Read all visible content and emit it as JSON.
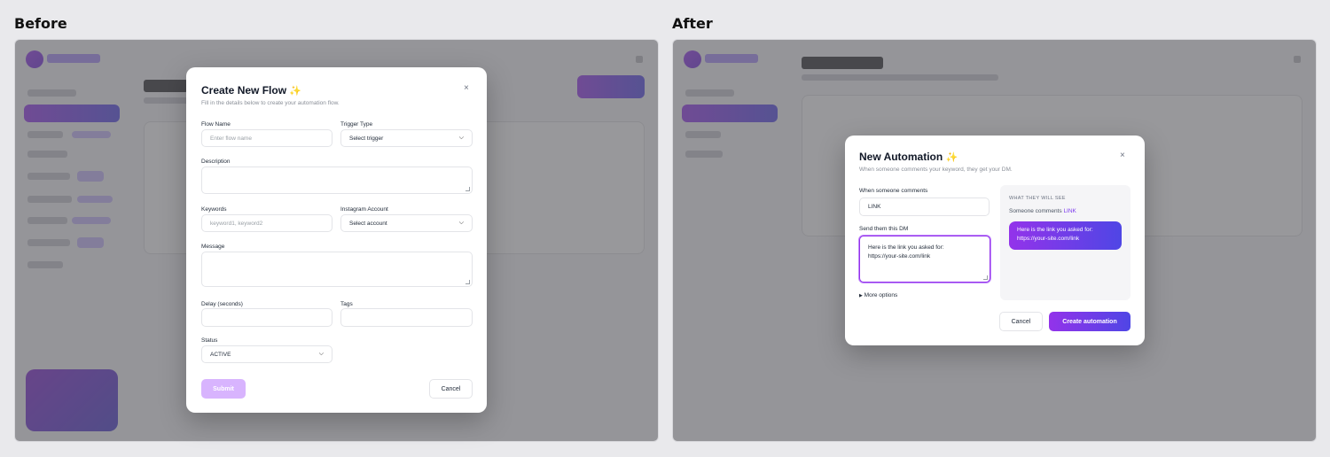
{
  "labels": {
    "before": "Before",
    "after": "After"
  },
  "before_modal": {
    "title": "Create New Flow",
    "title_emoji": "✨",
    "subtitle": "Fill in the details below to create your automation flow.",
    "close": "×",
    "fields": {
      "flow_name": {
        "label": "Flow Name",
        "placeholder": "Enter flow name"
      },
      "trigger_type": {
        "label": "Trigger Type",
        "value": "Select trigger"
      },
      "description": {
        "label": "Description"
      },
      "keywords": {
        "label": "Keywords",
        "placeholder": "keyword1, keyword2"
      },
      "instagram_account": {
        "label": "Instagram Account",
        "value": "Select account"
      },
      "message": {
        "label": "Message"
      },
      "delay": {
        "label": "Delay (seconds)"
      },
      "tags": {
        "label": "Tags"
      },
      "status": {
        "label": "Status",
        "value": "ACTIVE"
      }
    },
    "submit": "Submit",
    "cancel": "Cancel"
  },
  "after_modal": {
    "title": "New Automation",
    "title_emoji": "✨",
    "subtitle": "When someone comments your keyword, they get your DM.",
    "close": "×",
    "comment_label": "When someone comments",
    "comment_value": "LINK",
    "dm_label": "Send them this DM",
    "dm_value": "Here is the link you asked for: https://your-site.com/link",
    "more_options": "More options",
    "preview": {
      "caption": "WHAT THEY WILL SEE",
      "comment_prefix": "Someone comments",
      "keyword": "LINK",
      "bubble": "Here is the link you asked for: https://your-site.com/link"
    },
    "cancel": "Cancel",
    "create": "Create automation"
  },
  "colors": {
    "accent_start": "#9333ea",
    "accent_end": "#4f46e5",
    "overlay": "#5a5a5f"
  },
  "icons": {
    "close": "close-icon",
    "sparkle": "sparkles-icon",
    "expand": "triangle-right-icon",
    "select": "chevron-down-icon"
  }
}
